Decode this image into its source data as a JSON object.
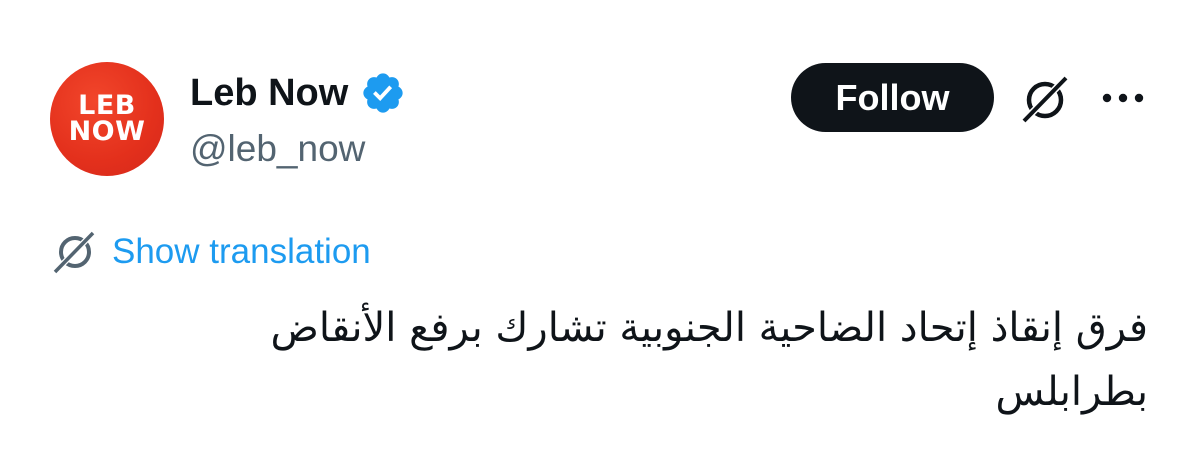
{
  "author": {
    "avatar_line1": "LEB",
    "avatar_line2": "NOW",
    "display_name": "Leb Now",
    "handle": "@leb_now",
    "verified": true,
    "avatar_color": "#e3301c",
    "verified_color": "#1d9bf0"
  },
  "actions": {
    "follow_label": "Follow",
    "grok_icon": "grok-icon",
    "more_icon": "more-icon"
  },
  "translation": {
    "label": "Show translation",
    "icon": "grok-icon"
  },
  "tweet": {
    "text": "فرق إنقاذ إتحاد الضاحية الجنوبية تشارك برفع الأنقاض بطرابلس"
  },
  "colors": {
    "text_primary": "#0f1419",
    "text_secondary": "#536471",
    "link": "#1d9bf0",
    "button_bg": "#0f1419"
  }
}
